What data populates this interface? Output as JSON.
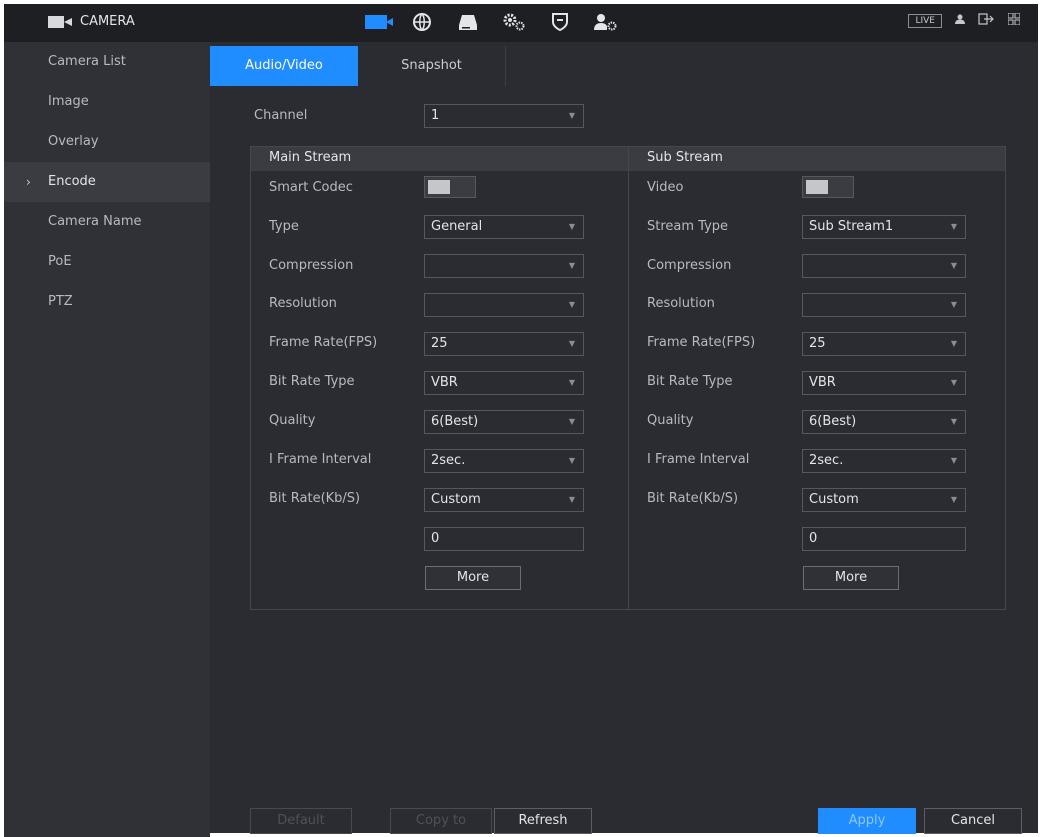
{
  "header": {
    "title": "CAMERA",
    "live": "LIVE",
    "icons": [
      "camera-icon",
      "network-icon",
      "storage-icon",
      "system-settings-icon",
      "security-icon",
      "account-icon"
    ]
  },
  "sidebar": {
    "items": [
      {
        "label": "Camera List"
      },
      {
        "label": "Image"
      },
      {
        "label": "Overlay"
      },
      {
        "label": "Encode"
      },
      {
        "label": "Camera Name"
      },
      {
        "label": "PoE"
      },
      {
        "label": "PTZ"
      }
    ],
    "active_chevron": "›"
  },
  "tabs": [
    {
      "label": "Audio/Video"
    },
    {
      "label": "Snapshot"
    }
  ],
  "channel": {
    "label": "Channel",
    "value": "1"
  },
  "main_stream": {
    "title": "Main Stream",
    "smart_codec_label": "Smart Codec",
    "type_label": "Type",
    "type_value": "General",
    "compression_label": "Compression",
    "compression_value": "",
    "resolution_label": "Resolution",
    "resolution_value": "",
    "frame_rate_label": "Frame Rate(FPS)",
    "frame_rate_value": "25",
    "bit_rate_type_label": "Bit Rate Type",
    "bit_rate_type_value": "VBR",
    "quality_label": "Quality",
    "quality_value": "6(Best)",
    "iframe_label": "I Frame Interval",
    "iframe_value": "2sec.",
    "bit_rate_label": "Bit Rate(Kb/S)",
    "bit_rate_value": "Custom",
    "bit_rate_custom": "0",
    "more_label": "More"
  },
  "sub_stream": {
    "title": "Sub Stream",
    "video_label": "Video",
    "stream_type_label": "Stream Type",
    "stream_type_value": "Sub Stream1",
    "compression_label": "Compression",
    "compression_value": "",
    "resolution_label": "Resolution",
    "resolution_value": "",
    "frame_rate_label": "Frame Rate(FPS)",
    "frame_rate_value": "25",
    "bit_rate_type_label": "Bit Rate Type",
    "bit_rate_type_value": "VBR",
    "quality_label": "Quality",
    "quality_value": "6(Best)",
    "iframe_label": "I Frame Interval",
    "iframe_value": "2sec.",
    "bit_rate_label": "Bit Rate(Kb/S)",
    "bit_rate_value": "Custom",
    "bit_rate_custom": "0",
    "more_label": "More"
  },
  "footer": {
    "default_label": "Default",
    "copy_label": "Copy to",
    "refresh_label": "Refresh",
    "apply_label": "Apply",
    "cancel_label": "Cancel"
  },
  "colors": {
    "accent": "#1f8cff",
    "background": "#2a2c31",
    "sidebar": "#2f3136"
  }
}
